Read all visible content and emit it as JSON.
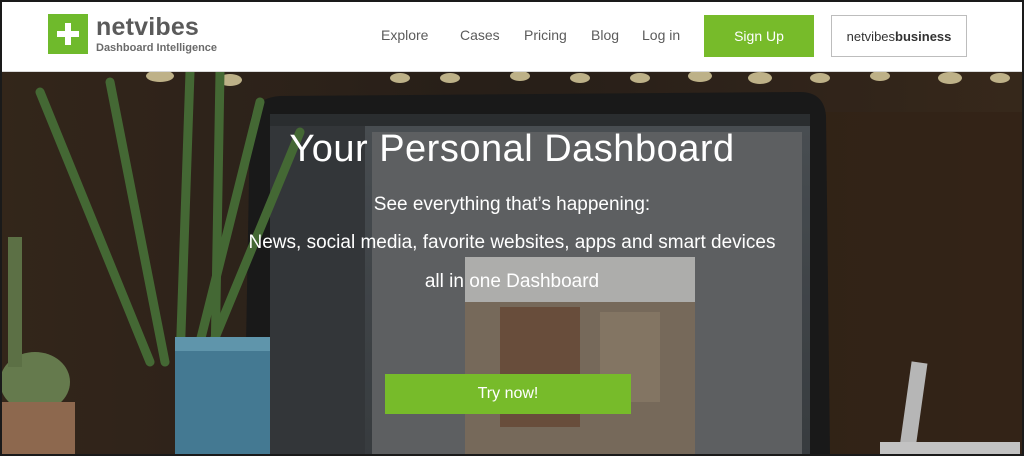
{
  "header": {
    "logo": {
      "name": "netvibes",
      "tagline": "Dashboard Intelligence"
    },
    "nav": [
      "Explore",
      "Cases",
      "Pricing",
      "Blog",
      "Log in"
    ],
    "signup_label": "Sign Up",
    "business_label_prefix": "netvibes",
    "business_label_bold": "business"
  },
  "hero": {
    "title": "Your Personal Dashboard",
    "line1": "See everything that’s happening:",
    "line2": "News, social media, favorite websites, apps and smart devices",
    "line3": "all in one Dashboard",
    "cta": "Try now!"
  },
  "colors": {
    "brand_green": "#77bb2a",
    "logo_green": "#6fba2c",
    "nav_text": "#5b5b5b"
  },
  "icons": [
    "netvibes-plus-logo-icon"
  ]
}
